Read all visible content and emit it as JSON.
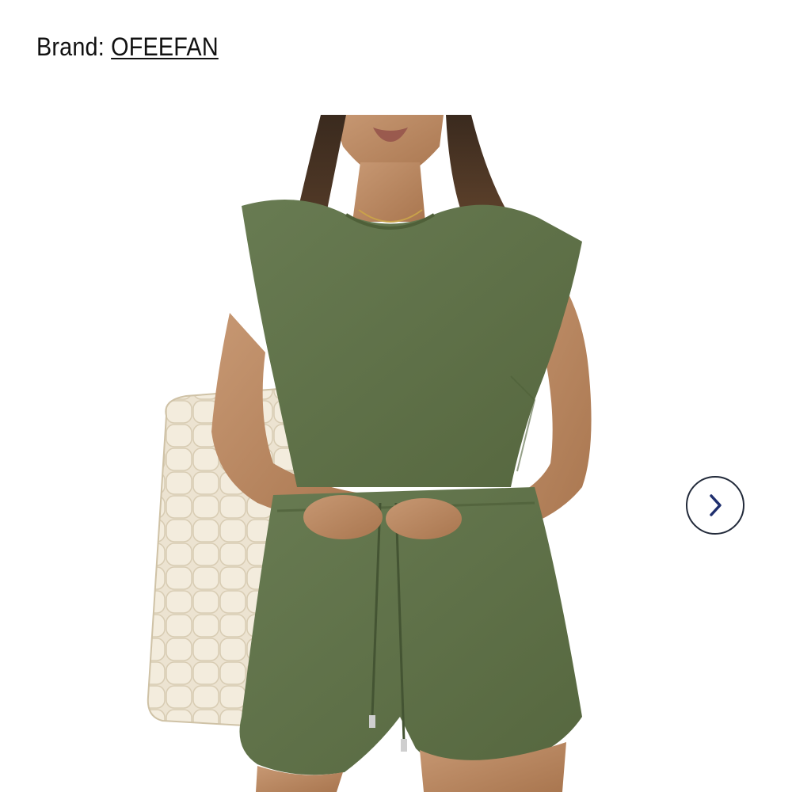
{
  "brand": {
    "label": "Brand:",
    "name": "OFEEFAN"
  },
  "gallery": {
    "image": "product-photo-model-green-sleeveless-top-shorts-set-with-quilted-tote",
    "next_icon": "chevron-right-icon"
  },
  "colors": {
    "garment": "#5e7049",
    "tote": "#ece3d1",
    "button_border": "#222a3a",
    "chevron": "#1f2f6e"
  }
}
